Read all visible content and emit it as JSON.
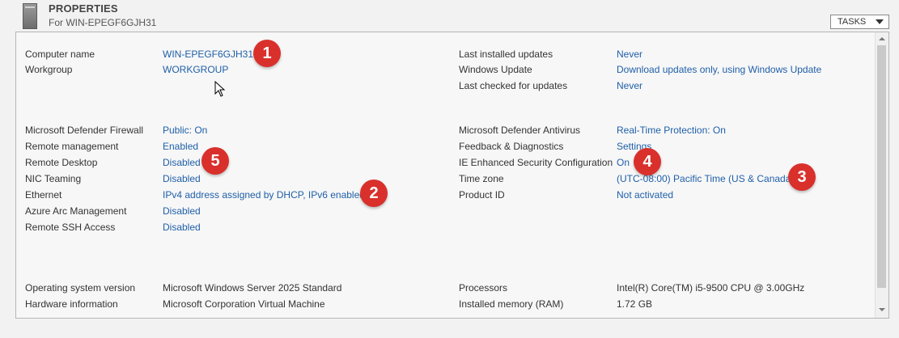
{
  "header": {
    "title": "PROPERTIES",
    "subtitle": "For WIN-EPEGF6GJH31",
    "tasks_label": "TASKS"
  },
  "left_top": [
    {
      "label": "Computer name",
      "value": "WIN-EPEGF6GJH31"
    },
    {
      "label": "Workgroup",
      "value": "WORKGROUP"
    }
  ],
  "right_top": [
    {
      "label": "Last installed updates",
      "value": "Never"
    },
    {
      "label": "Windows Update",
      "value": "Download updates only, using Windows Update"
    },
    {
      "label": "Last checked for updates",
      "value": "Never"
    }
  ],
  "left_mid": [
    {
      "label": "Microsoft Defender Firewall",
      "value": "Public: On"
    },
    {
      "label": "Remote management",
      "value": "Enabled"
    },
    {
      "label": "Remote Desktop",
      "value": "Disabled"
    },
    {
      "label": "NIC Teaming",
      "value": "Disabled"
    },
    {
      "label": "Ethernet",
      "value": "IPv4 address assigned by DHCP, IPv6 enabled"
    },
    {
      "label": "Azure Arc Management",
      "value": "Disabled"
    },
    {
      "label": "Remote SSH Access",
      "value": "Disabled"
    }
  ],
  "right_mid": [
    {
      "label": "Microsoft Defender Antivirus",
      "value": "Real-Time Protection: On"
    },
    {
      "label": "Feedback & Diagnostics",
      "value": "Settings"
    },
    {
      "label": "IE Enhanced Security Configuration",
      "value": "On"
    },
    {
      "label": "Time zone",
      "value": "(UTC-08:00) Pacific Time (US & Canada)"
    },
    {
      "label": "Product ID",
      "value": "Not activated"
    }
  ],
  "left_bottom": [
    {
      "label": "Operating system version",
      "value": "Microsoft Windows Server 2025 Standard"
    },
    {
      "label": "Hardware information",
      "value": "Microsoft Corporation Virtual Machine"
    }
  ],
  "right_bottom": [
    {
      "label": "Processors",
      "value": "Intel(R) Core(TM) i5-9500 CPU @ 3.00GHz"
    },
    {
      "label": "Installed memory (RAM)",
      "value": "1.72 GB"
    }
  ],
  "badges": [
    "1",
    "2",
    "3",
    "4",
    "5"
  ],
  "colors": {
    "link": "#1f5fa8",
    "badge": "#d9302c"
  }
}
